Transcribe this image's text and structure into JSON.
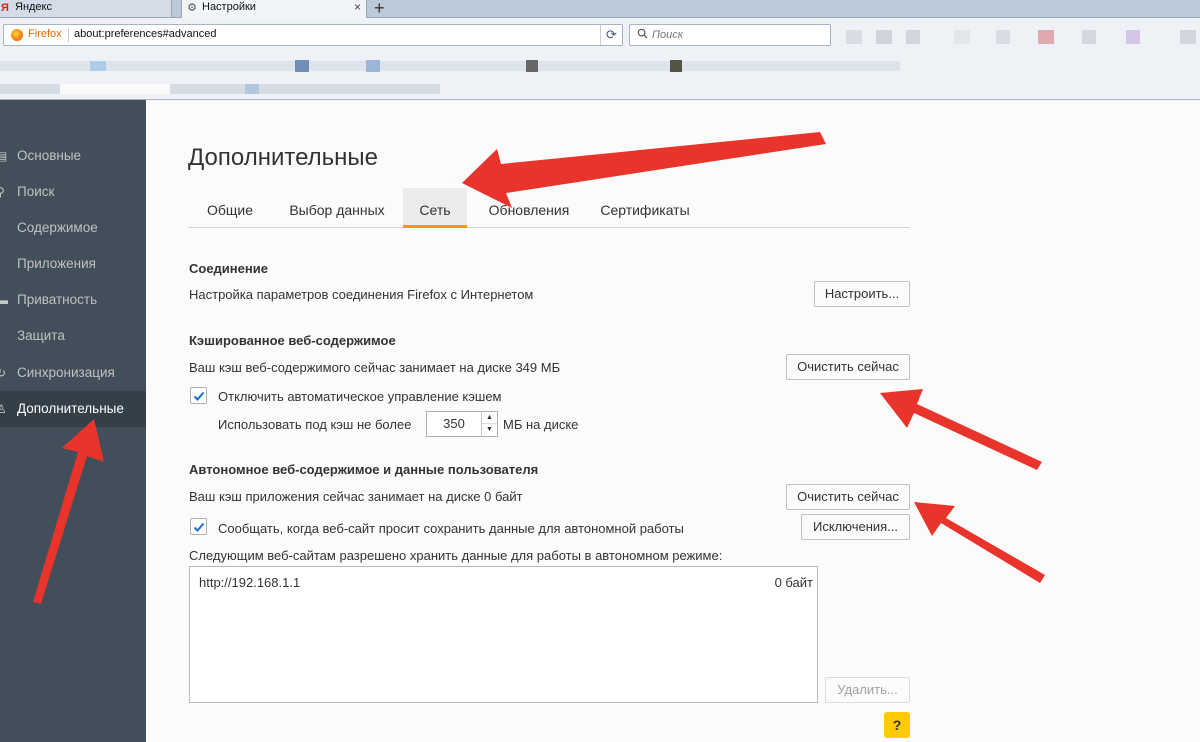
{
  "browser": {
    "tabs": [
      {
        "label": "Яндекс",
        "icon": "yandex-icon"
      },
      {
        "label": "Настройки",
        "icon": "gear-icon"
      }
    ],
    "identity_label": "Firefox",
    "url": "about:preferences#advanced",
    "search_placeholder": "Поиск"
  },
  "sidebar": {
    "items": [
      {
        "label": "Основные",
        "icon": "general-icon"
      },
      {
        "label": "Поиск",
        "icon": "search-icon"
      },
      {
        "label": "Содержимое",
        "icon": "content-icon"
      },
      {
        "label": "Приложения",
        "icon": "applications-icon"
      },
      {
        "label": "Приватность",
        "icon": "privacy-icon"
      },
      {
        "label": "Защита",
        "icon": "security-icon"
      },
      {
        "label": "Синхронизация",
        "icon": "sync-icon"
      },
      {
        "label": "Дополнительные",
        "icon": "advanced-icon"
      }
    ],
    "active_index": 7
  },
  "main": {
    "title": "Дополнительные",
    "tabs": [
      {
        "label": "Общие"
      },
      {
        "label": "Выбор данных"
      },
      {
        "label": "Сеть"
      },
      {
        "label": "Обновления"
      },
      {
        "label": "Сертификаты"
      }
    ],
    "active_tab": 2,
    "connection": {
      "heading": "Соединение",
      "description": "Настройка параметров соединения Firefox с Интернетом",
      "button": "Настроить..."
    },
    "cache": {
      "heading": "Кэшированное веб-содержимое",
      "usage": "Ваш кэш веб-содержимого сейчас занимает на диске 349 МБ",
      "clear_button": "Очистить сейчас",
      "override_label": "Отключить автоматическое управление кэшем",
      "override_checked": true,
      "limit_prefix": "Использовать под кэш не более",
      "limit_value": "350",
      "limit_suffix": "МБ на диске"
    },
    "offline": {
      "heading": "Автономное веб-содержимое и данные пользователя",
      "usage": "Ваш кэш приложения сейчас занимает на диске 0 байт",
      "clear_button": "Очистить сейчас",
      "notify_label": "Сообщать, когда веб-сайт просит сохранить данные для автономной работы",
      "notify_checked": true,
      "exceptions_button": "Исключения...",
      "list_label": "Следующим веб-сайтам разрешено хранить данные для работы в автономном режиме:",
      "sites": [
        {
          "site": "http://192.168.1.1",
          "size": "0 байт"
        }
      ],
      "remove_button": "Удалить..."
    },
    "help_label": "?"
  },
  "colors": {
    "sidebar_bg": "#424f5a",
    "sidebar_active_bg": "#343f48",
    "tab_accent": "#ff9500",
    "help_button": "#ffcb00",
    "annotation_arrow": "#e8342a"
  }
}
